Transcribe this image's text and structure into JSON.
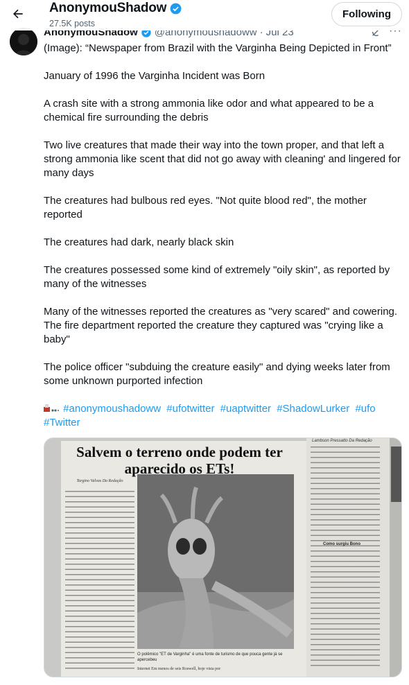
{
  "header": {
    "display_name": "AnonymouShadow",
    "post_count": "27.5K posts",
    "follow_label": "Following",
    "back_icon": "arrow-left-icon",
    "verified_icon": "verified-badge-icon",
    "verified_color": "#1d9bf0"
  },
  "post": {
    "display_name": "AnonymouShadow",
    "handle": "@anonymoushadoww",
    "date": "Jul 23",
    "more_label": "···",
    "paragraphs": [
      "(Image): “Newspaper from Brazil with the Varginha Being Depicted in Front”",
      "January of 1996 the Varginha Incident was Born",
      "A crash site with a strong ammonia like odor and what appeared to be a chemical fire surrounding the debris",
      "Two live creatures that made their way into the town proper, and that left a strong ammonia like scent that did not go away with cleaning' and lingered for many days",
      "The creatures had bulbous red eyes. \"Not quite blood red\", the mother reported",
      "The creatures had dark, nearly black skin",
      "The creatures possessed some kind of extremely \"oily skin\", as reported by many of the witnesses",
      "Many of the witnesses reported the creatures as \"very scared\" and cowering. The fire department reported the creature they captured was \"crying like a baby\"",
      "The police officer \"subduing the creature easily\" and dying weeks later from some unknown purported infection"
    ],
    "hashtags": [
      "#anonymoushadoww",
      "#ufotwitter",
      "#uaptwitter",
      "#ShadowLurker",
      "#ufo",
      "#Twitter"
    ],
    "hashtag_color": "#1d9bf0"
  },
  "image": {
    "headline": "Salvem o terreno onde podem ter aparecido os ETs!",
    "credit": "Targino Valvas Da Redação",
    "caption": "O polêmico \"ET de Varginha\" é uma fonte de turismo de que pouca gente já se apercebeu",
    "bottom_text": "Internet  Em menos de seis  Roswell, hoje vista por",
    "right_credit": "Lambson Pressatto Da Redação",
    "right_subhead": "Como surgiu Bono"
  }
}
